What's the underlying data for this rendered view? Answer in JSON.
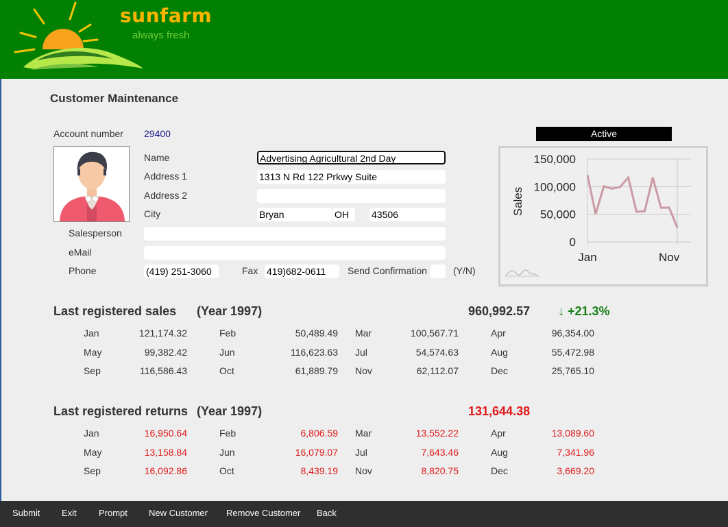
{
  "header": {
    "brand": "sunfarm",
    "tagline": "always fresh"
  },
  "page_title": "Customer Maintenance",
  "status": "Active",
  "form": {
    "account_label": "Account number",
    "account_value": "29400",
    "name_label": "Name",
    "name_value": "Advertising Agricultural 2nd Day",
    "address1_label": "Address 1",
    "address1_value": "1313 N Rd 122 Prkwy Suite",
    "address2_label": "Address 2",
    "address2_value": "",
    "city_label": "City",
    "city_value": "Bryan",
    "state_value": "OH",
    "zip_value": "43506",
    "salesperson_label": "Salesperson",
    "salesperson_value": "",
    "email_label": "eMail",
    "email_value": "",
    "phone_label": "Phone",
    "phone_value": "(419) 251-3060",
    "fax_label": "Fax",
    "fax_value": "419)682-0611",
    "confirm_label": "Send Confirmation",
    "confirm_value": "",
    "confirm_hint": "(Y/N)"
  },
  "chart_data": {
    "type": "line",
    "ylabel": "Sales",
    "x": [
      "Jan",
      "Feb",
      "Mar",
      "Apr",
      "May",
      "Jun",
      "Jul",
      "Aug",
      "Sep",
      "Oct",
      "Nov",
      "Dec"
    ],
    "x_tick_labels": [
      "Jan",
      "Nov"
    ],
    "y_ticks": [
      "150,000",
      "100,000",
      "50,000",
      "0"
    ],
    "ylim": [
      0,
      150000
    ],
    "series": [
      {
        "values": [
          121174.32,
          50489.49,
          100567.71,
          96354.0,
          99382.42,
          116623.63,
          54574.63,
          55472.98,
          116586.43,
          61889.79,
          62112.07,
          25765.1
        ]
      }
    ],
    "line_color": "#cc9aa5",
    "grid": true
  },
  "sales": {
    "title": "Last registered sales",
    "year": "(Year 1997)",
    "total": "960,992.57",
    "trend": "↓ +21.3%",
    "months": [
      {
        "m": "Jan",
        "v": "121,174.32"
      },
      {
        "m": "Feb",
        "v": "50,489.49"
      },
      {
        "m": "Mar",
        "v": "100,567.71"
      },
      {
        "m": "Apr",
        "v": "96,354.00"
      },
      {
        "m": "May",
        "v": "99,382.42"
      },
      {
        "m": "Jun",
        "v": "116,623.63"
      },
      {
        "m": "Jul",
        "v": "54,574.63"
      },
      {
        "m": "Aug",
        "v": "55,472.98"
      },
      {
        "m": "Sep",
        "v": "116,586.43"
      },
      {
        "m": "Oct",
        "v": "61,889.79"
      },
      {
        "m": "Nov",
        "v": "62,112.07"
      },
      {
        "m": "Dec",
        "v": "25,765.10"
      }
    ]
  },
  "returns": {
    "title": "Last registered returns",
    "year": "(Year 1997)",
    "total": "131,644.38",
    "months": [
      {
        "m": "Jan",
        "v": "16,950.64"
      },
      {
        "m": "Feb",
        "v": "6,806.59"
      },
      {
        "m": "Mar",
        "v": "13,552.22"
      },
      {
        "m": "Apr",
        "v": "13,089.60"
      },
      {
        "m": "May",
        "v": "13,158.84"
      },
      {
        "m": "Jun",
        "v": "16,079.07"
      },
      {
        "m": "Jul",
        "v": "7,643.46"
      },
      {
        "m": "Aug",
        "v": "7,341.96"
      },
      {
        "m": "Sep",
        "v": "16,092.86"
      },
      {
        "m": "Oct",
        "v": "8,439.19"
      },
      {
        "m": "Nov",
        "v": "8,820.75"
      },
      {
        "m": "Dec",
        "v": "3,669.20"
      }
    ]
  },
  "colors": {
    "header_bg": "#018001",
    "brand": "#ffb400",
    "tagline": "#6fcf3a",
    "returns_total": "#e01a1a",
    "trend": "#1a7f1a",
    "footer_bg": "#2f2f2f"
  },
  "footer": {
    "buttons": [
      "Submit",
      "Exit",
      "Prompt",
      "New Customer",
      "Remove Customer",
      "Back"
    ]
  }
}
